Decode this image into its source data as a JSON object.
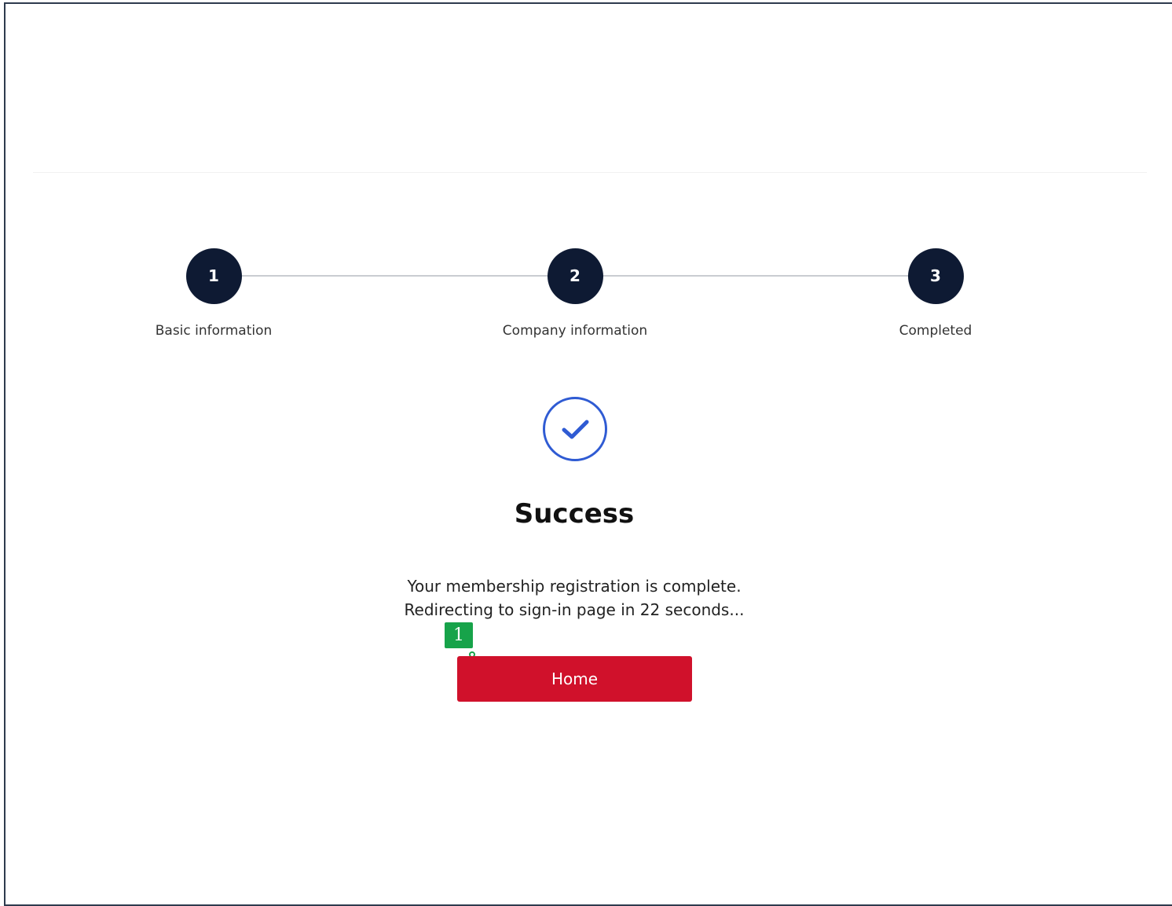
{
  "steps": [
    {
      "number": "1",
      "label": "Basic information"
    },
    {
      "number": "2",
      "label": "Company information"
    },
    {
      "number": "3",
      "label": "Completed"
    }
  ],
  "result": {
    "icon": "check-circle-icon",
    "title": "Success",
    "line1": "Your membership registration is complete.",
    "line2": "Redirecting to sign-in page in 22 seconds..."
  },
  "actions": {
    "home_label": "Home"
  },
  "annotation": {
    "marker_label": "1"
  },
  "colors": {
    "step_circle": "#0e1a33",
    "accent_blue": "#2f5bd3",
    "button_red": "#d0112b",
    "marker_green": "#17a34a"
  }
}
